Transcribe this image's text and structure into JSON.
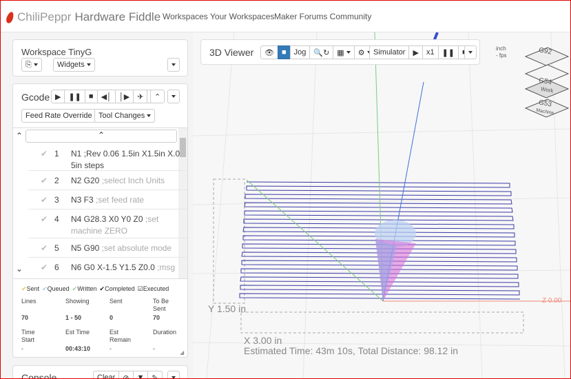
{
  "navbar": {
    "brand_pepper": "ChiliPeppr",
    "brand_rest": "Hardware Fiddle",
    "links": [
      "Workspaces",
      "Your Workspaces",
      "Maker Forums Community"
    ]
  },
  "workspace": {
    "title": "Workspace TinyG",
    "widgets_label": "Widgets"
  },
  "gcode": {
    "title": "Gcode",
    "feed_rate_label": "Feed Rate Override",
    "tool_changes_label": "Tool Changes",
    "lines": [
      {
        "num": "1",
        "code": "N1",
        "comment": ";Rev 0.06 1.5in X1.5in X.0 5in steps"
      },
      {
        "num": "2",
        "code": "N2 G20",
        "comment": ";select Inch Units"
      },
      {
        "num": "3",
        "code": "N3 F3",
        "comment": ";set feed rate"
      },
      {
        "num": "4",
        "code": "N4 G28.3 X0 Y0 Z0",
        "comment": ";set machine ZERO"
      },
      {
        "num": "5",
        "code": "N5 G90",
        "comment": ";set absolute mode"
      },
      {
        "num": "6",
        "code": "N6 G0 X-1.5 Y1.5 Z0.0",
        "comment": ";msg"
      }
    ],
    "legend": [
      "Sent",
      "Queued",
      "Written",
      "Completed",
      "Executed"
    ],
    "stats": {
      "lines_label": "Lines",
      "lines_val": "70",
      "showing_label": "Showing",
      "showing_val": "1 - 50",
      "sent_label": "Sent",
      "sent_val": "0",
      "tobesent_label": "To Be Sent",
      "tobesent_val": "70",
      "timestart_label": "Time Start",
      "timestart_val": "-",
      "esttime_label": "Est Time",
      "esttime_val": "00:43:10",
      "estremain_label": "Est Remain",
      "estremain_val": "-",
      "duration_label": "Duration",
      "duration_val": "-"
    }
  },
  "console": {
    "title": "Console",
    "clear_label": "Clear"
  },
  "viewer": {
    "title": "3D Viewer",
    "jog_label": "Jog",
    "simulator_label": "Simulator",
    "speed_label": "x1",
    "units": "inch",
    "fps": "- fps",
    "views": [
      "G92",
      "Work",
      "G54",
      "G53",
      "Machine"
    ],
    "y_dim": "Y 1.50 in",
    "x_dim": "X 3.00 in",
    "z_dim": "Z 0.00",
    "estimate": "Estimated Time: 43m 10s, Total Distance: 98.12 in"
  }
}
